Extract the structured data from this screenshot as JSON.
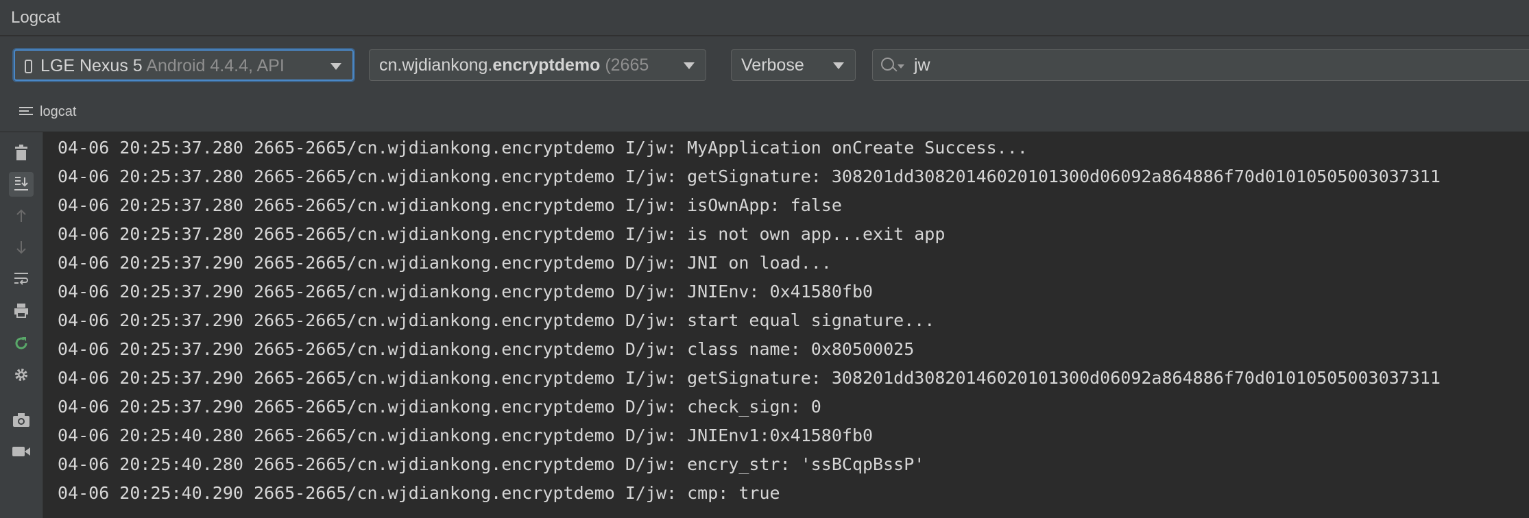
{
  "window": {
    "title": "Logcat"
  },
  "toolbar": {
    "device": {
      "name": "LGE Nexus 5",
      "detail": "Android 4.4.4, API"
    },
    "process": {
      "prefix": "cn.wjdiankong.",
      "name": "encryptdemo",
      "suffix": "(2665"
    },
    "level": "Verbose",
    "search_value": "jw"
  },
  "tab": {
    "label": "logcat"
  },
  "sidebar": [
    {
      "icon": "trash-icon",
      "state": "normal"
    },
    {
      "icon": "scroll-to-end-icon",
      "state": "active"
    },
    {
      "icon": "arrow-up-icon",
      "state": "disabled"
    },
    {
      "icon": "arrow-down-icon",
      "state": "disabled"
    },
    {
      "icon": "soft-wrap-icon",
      "state": "normal"
    },
    {
      "icon": "print-icon",
      "state": "normal"
    },
    {
      "icon": "restart-icon",
      "state": "green"
    },
    {
      "icon": "gear-icon",
      "state": "normal"
    },
    {
      "icon": "camera-icon",
      "state": "normal"
    },
    {
      "icon": "video-icon",
      "state": "normal"
    }
  ],
  "log_lines": [
    "04-06 20:25:37.280 2665-2665/cn.wjdiankong.encryptdemo I/jw: MyApplication onCreate Success...",
    "04-06 20:25:37.280 2665-2665/cn.wjdiankong.encryptdemo I/jw: getSignature: 308201dd3082014602010130 0d06092a864886f70d01010505003037311",
    "04-06 20:25:37.280 2665-2665/cn.wjdiankong.encryptdemo I/jw: isOwnApp: false",
    "04-06 20:25:37.280 2665-2665/cn.wjdiankong.encryptdemo I/jw: is not own app...exit app",
    "04-06 20:25:37.290 2665-2665/cn.wjdiankong.encryptdemo D/jw: JNI on load...",
    "04-06 20:25:37.290 2665-2665/cn.wjdiankong.encryptdemo D/jw: JNIEnv: 0x41580fb0",
    "04-06 20:25:37.290 2665-2665/cn.wjdiankong.encryptdemo D/jw: start equal signature...",
    "04-06 20:25:37.290 2665-2665/cn.wjdiankong.encryptdemo D/jw: class name: 0x80500025",
    "04-06 20:25:37.290 2665-2665/cn.wjdiankong.encryptdemo I/jw: getSignature: 308201dd3082014602010130 0d06092a864886f70d01010505003037311",
    "04-06 20:25:37.290 2665-2665/cn.wjdiankong.encryptdemo D/jw: check_sign: 0",
    "04-06 20:25:40.280 2665-2665/cn.wjdiankong.encryptdemo D/jw: JNIEnv1:0x41580fb0",
    "04-06 20:25:40.280 2665-2665/cn.wjdiankong.encryptdemo D/jw: encry_str: 'ssBCqpBssP'",
    "04-06 20:25:40.290 2665-2665/cn.wjdiankong.encryptdemo I/jw: cmp: true"
  ]
}
